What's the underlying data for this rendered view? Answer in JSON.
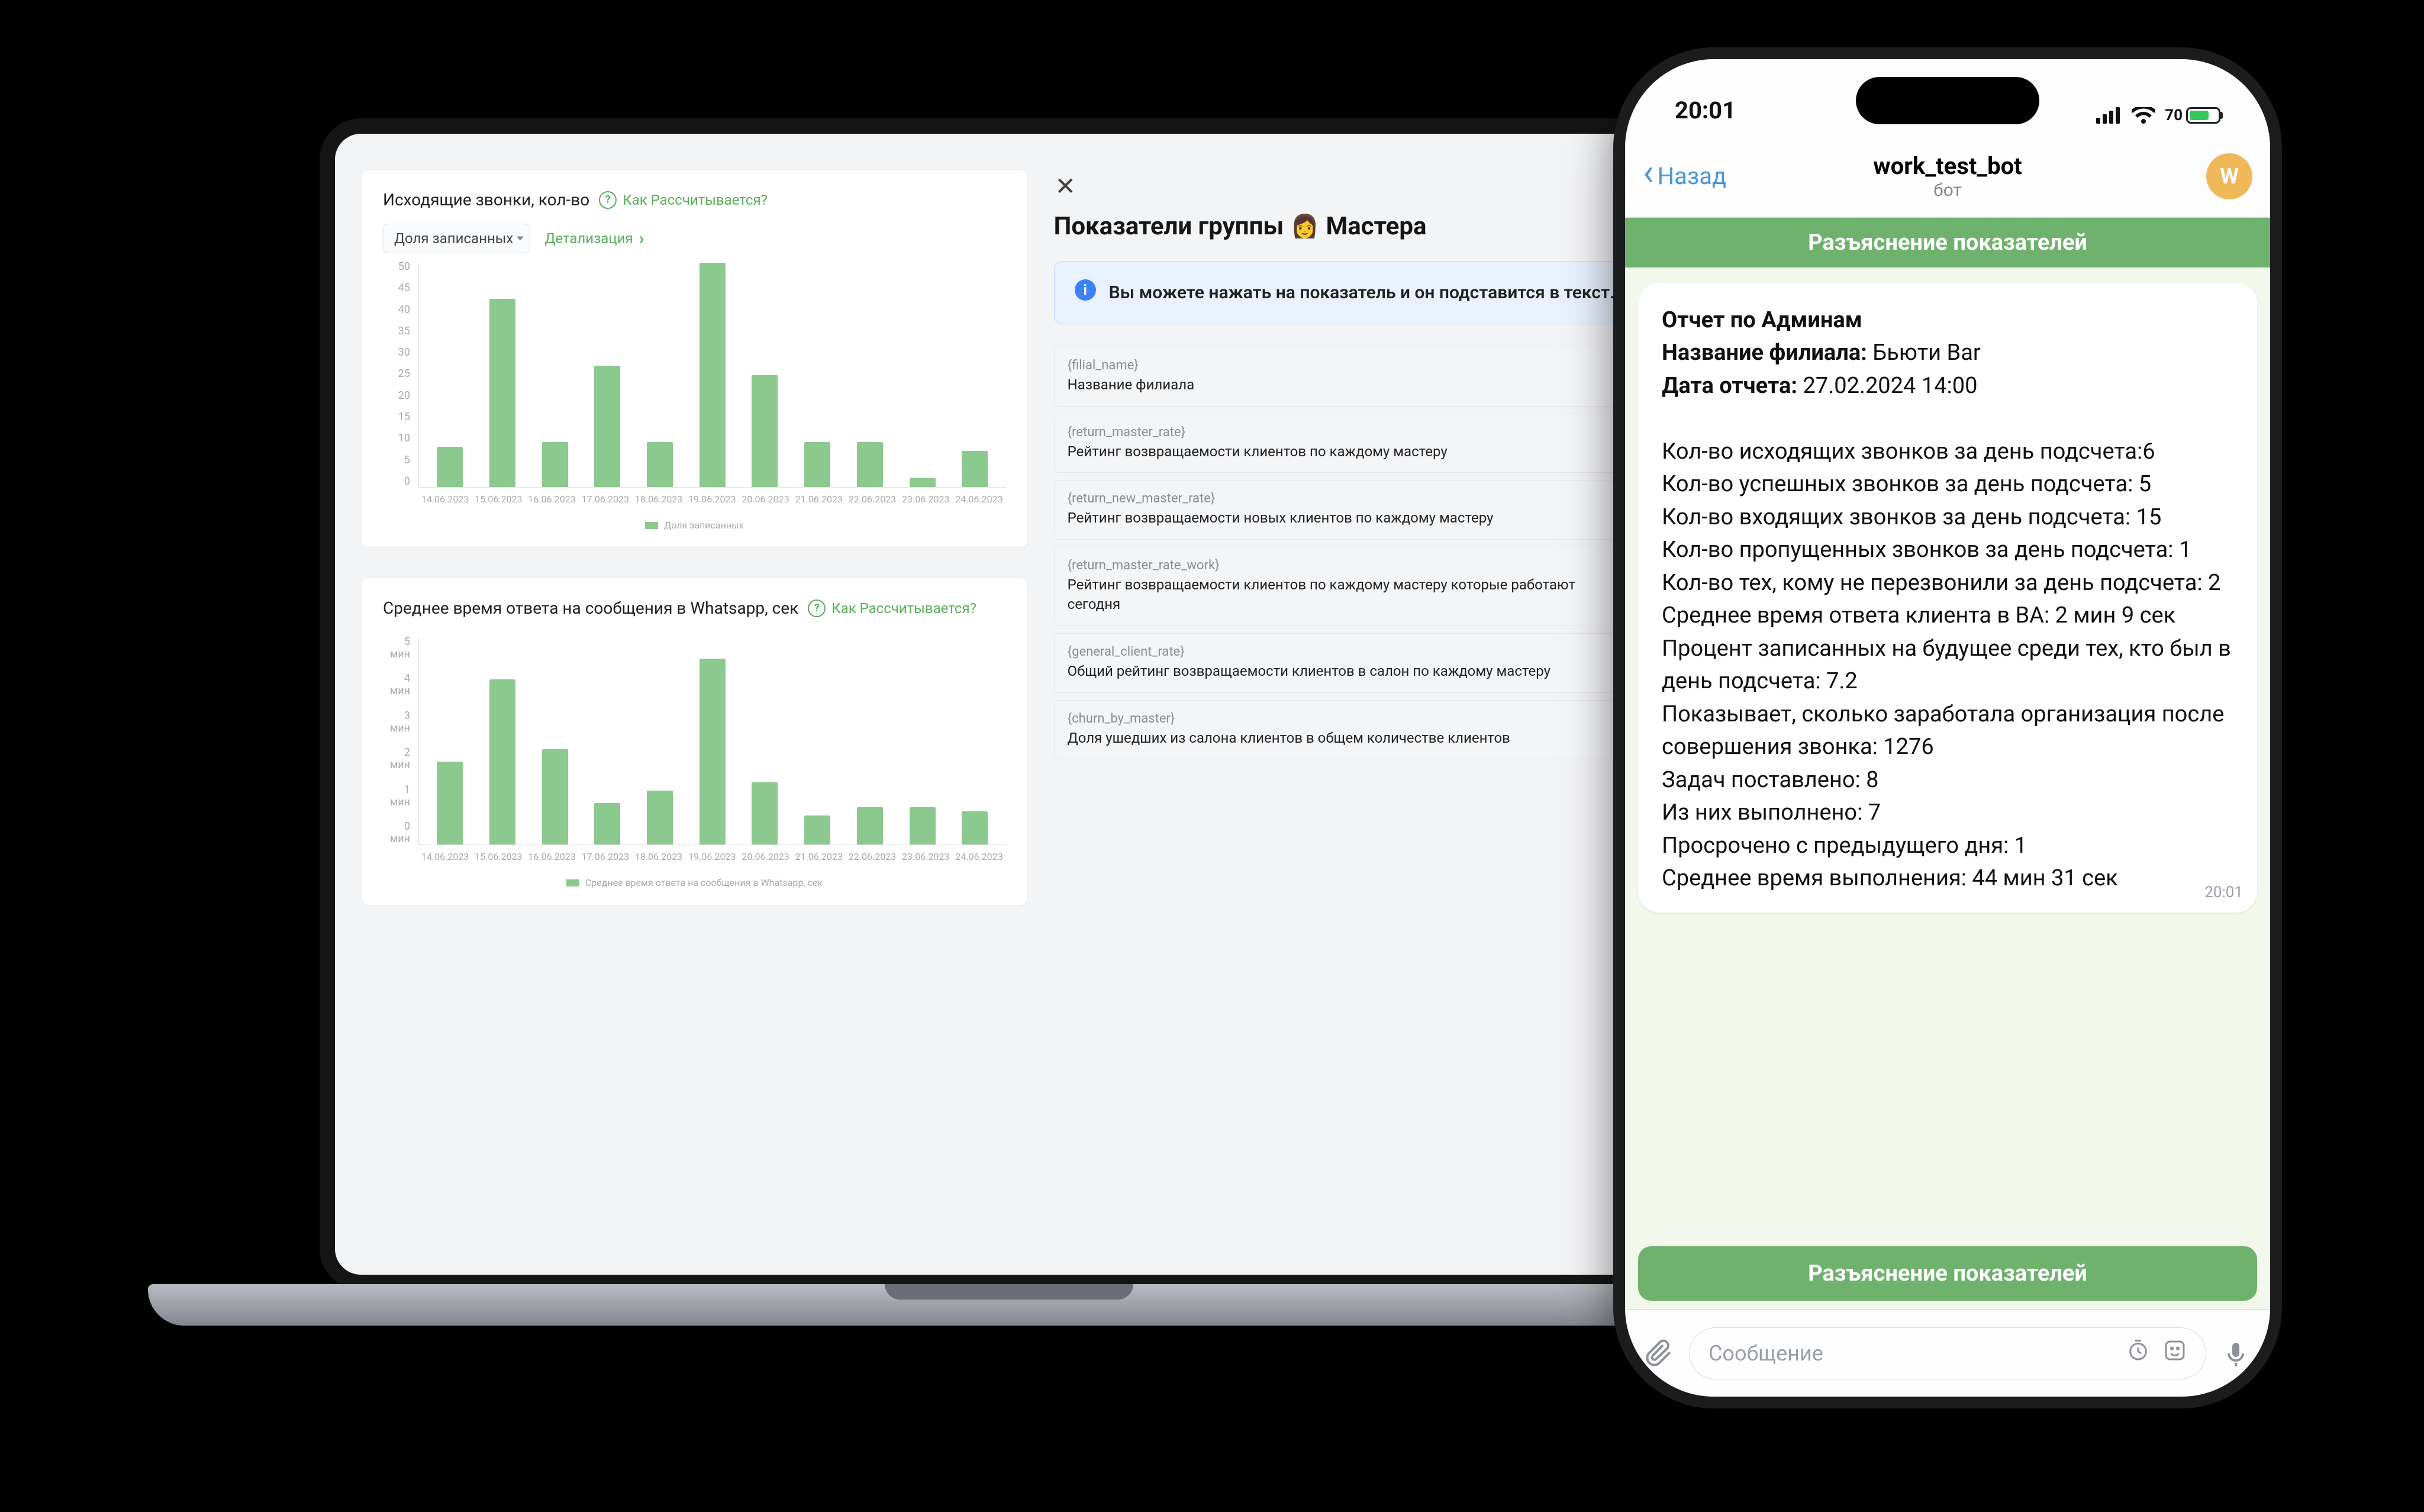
{
  "chart_data": [
    {
      "type": "bar",
      "title": "Исходящие звонки, кол-во",
      "ylabel": "",
      "ylim": [
        0,
        50
      ],
      "categories": [
        "14.06.2023",
        "15.06.2023",
        "16.06.2023",
        "17.06.2023",
        "18.06.2023",
        "19.06.2023",
        "20.06.2023",
        "21.06.2023",
        "22.06.2023",
        "23.06.2023",
        "24.06.2023"
      ],
      "values": [
        9,
        42,
        10,
        27,
        10,
        50,
        25,
        10,
        10,
        2,
        8
      ],
      "legend": "Доля записанных"
    },
    {
      "type": "bar",
      "title": "Среднее время ответа на сообщения в Whatsapp, сек",
      "ylabel": "",
      "ylim": [
        0,
        5
      ],
      "y_ticks": [
        "0 мин",
        "1 мин",
        "2 мин",
        "3 мин",
        "4 мин",
        "5 мин"
      ],
      "categories": [
        "14.06.2023",
        "15.06.2023",
        "16.06.2023",
        "17.06.2023",
        "18.06.2023",
        "19.06.2023",
        "20.06.2023",
        "21.06.2023",
        "22.06.2023",
        "23.06.2023",
        "24.06.2023"
      ],
      "values": [
        2.0,
        4.0,
        2.3,
        1.0,
        1.3,
        4.5,
        1.5,
        0.7,
        0.9,
        0.9,
        0.8
      ],
      "legend": "Среднее время ответа на сообщения в Whatsapp, сек"
    }
  ],
  "dashboard": {
    "help": "Как Рассчитывается?",
    "select": "Доля записанных",
    "detail": "Детализация"
  },
  "group": {
    "title_prefix": "Показатели группы",
    "emoji": "👩",
    "title_suffix": "Мастера",
    "info": "Вы можете нажать на показатель и он подставится в текст.",
    "rows": [
      {
        "code": "{filial_name}",
        "label": "Название филиала"
      },
      {
        "code": "{return_master_rate}",
        "label": "Рейтинг возвращаемости клиентов по каждому мастеру"
      },
      {
        "code": "{return_new_master_rate}",
        "label": "Рейтинг возвращаемости новых клиентов по каждому мастеру"
      },
      {
        "code": "{return_master_rate_work}",
        "label": "Рейтинг возвращаемости клиентов по каждому мастеру которые работают сегодня"
      },
      {
        "code": "{general_client_rate}",
        "label": "Общий рейтинг возвращаемости клиентов в салон по каждому мастеру"
      },
      {
        "code": "{churn_by_master}",
        "label": "Доля ушедших из салона клиентов в общем количестве клиентов"
      }
    ]
  },
  "phone": {
    "time": "20:01",
    "battery": "70",
    "back": "Назад",
    "title": "work_test_bot",
    "subtitle": "бот",
    "avatar": "W",
    "banner": "Разъяснение показателей",
    "kb_button": "Разъяснение показателей",
    "placeholder": "Сообщение",
    "msg_ts": "20:01",
    "report": {
      "l1": "Отчет по Админам",
      "l2k": "Название филиала:",
      "l2v": " Бьюти Bar",
      "l3k": "Дата отчета:",
      "l3v": " 27.02.2024 14:00",
      "lines": [
        "Кол-во исходящих звонков за день подсчета:6",
        "Кол-во успешных звонков за день подсчета: 5",
        "Кол-во входящих звонков за день подсчета: 15",
        "Кол-во пропущенных звонков за день подсчета: 1",
        "Кол-во тех, кому не перезвонили за день подсчета: 2",
        "Среднее время ответа клиента в ВА: 2 мин 9 сек",
        "Процент записанных на будущее среди тех, кто был в день подсчета: 7.2",
        "Показывает, сколько заработала организация после совершения звонка: 1276",
        "Задач поставлено: 8",
        "Из них выполнено: 7",
        "Просрочено с предыдущего дня: 1",
        "Среднее время выполнения: 44 мин 31 сек"
      ]
    }
  }
}
